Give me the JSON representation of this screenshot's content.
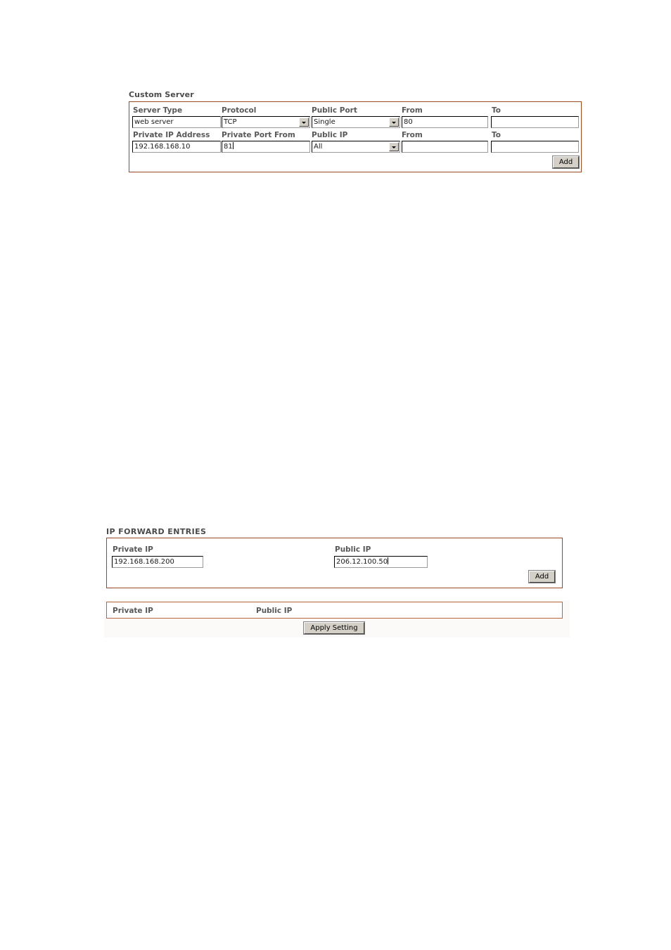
{
  "custom_server": {
    "title": "Custom Server",
    "fields": {
      "server_type_label": "Server Type",
      "server_type_value": "web server",
      "protocol_label": "Protocol",
      "protocol_value": "TCP",
      "public_port_label": "Public Port",
      "public_port_value": "Single",
      "public_port_from_label": "From",
      "public_port_from_value": "80",
      "public_port_to_label": "To",
      "public_port_to_value": "",
      "private_ip_label": "Private IP Address",
      "private_ip_value": "192.168.168.10",
      "private_port_from_label": "Private Port From",
      "private_port_from_value": "81",
      "public_ip_label": "Public IP",
      "public_ip_value": "All",
      "public_ip_from_label": "From",
      "public_ip_from_value": "",
      "public_ip_to_label": "To",
      "public_ip_to_value": ""
    },
    "add_button": "Add"
  },
  "ip_forward": {
    "title": "IP FORWARD ENTRIES",
    "private_ip_label": "Private IP",
    "private_ip_value": "192.168.168.200",
    "public_ip_label": "Public IP",
    "public_ip_value": "206.12.100.50",
    "add_button": "Add",
    "table": {
      "columns": [
        "Private IP",
        "Public IP"
      ],
      "rows": []
    },
    "apply_button": "Apply Setting"
  },
  "colors": {
    "panel_border": "#9c4a22",
    "table_border": "#b5663c",
    "label_text": "#585858",
    "title_text": "#4a4a4a",
    "button_face": "#d4d0c8"
  }
}
